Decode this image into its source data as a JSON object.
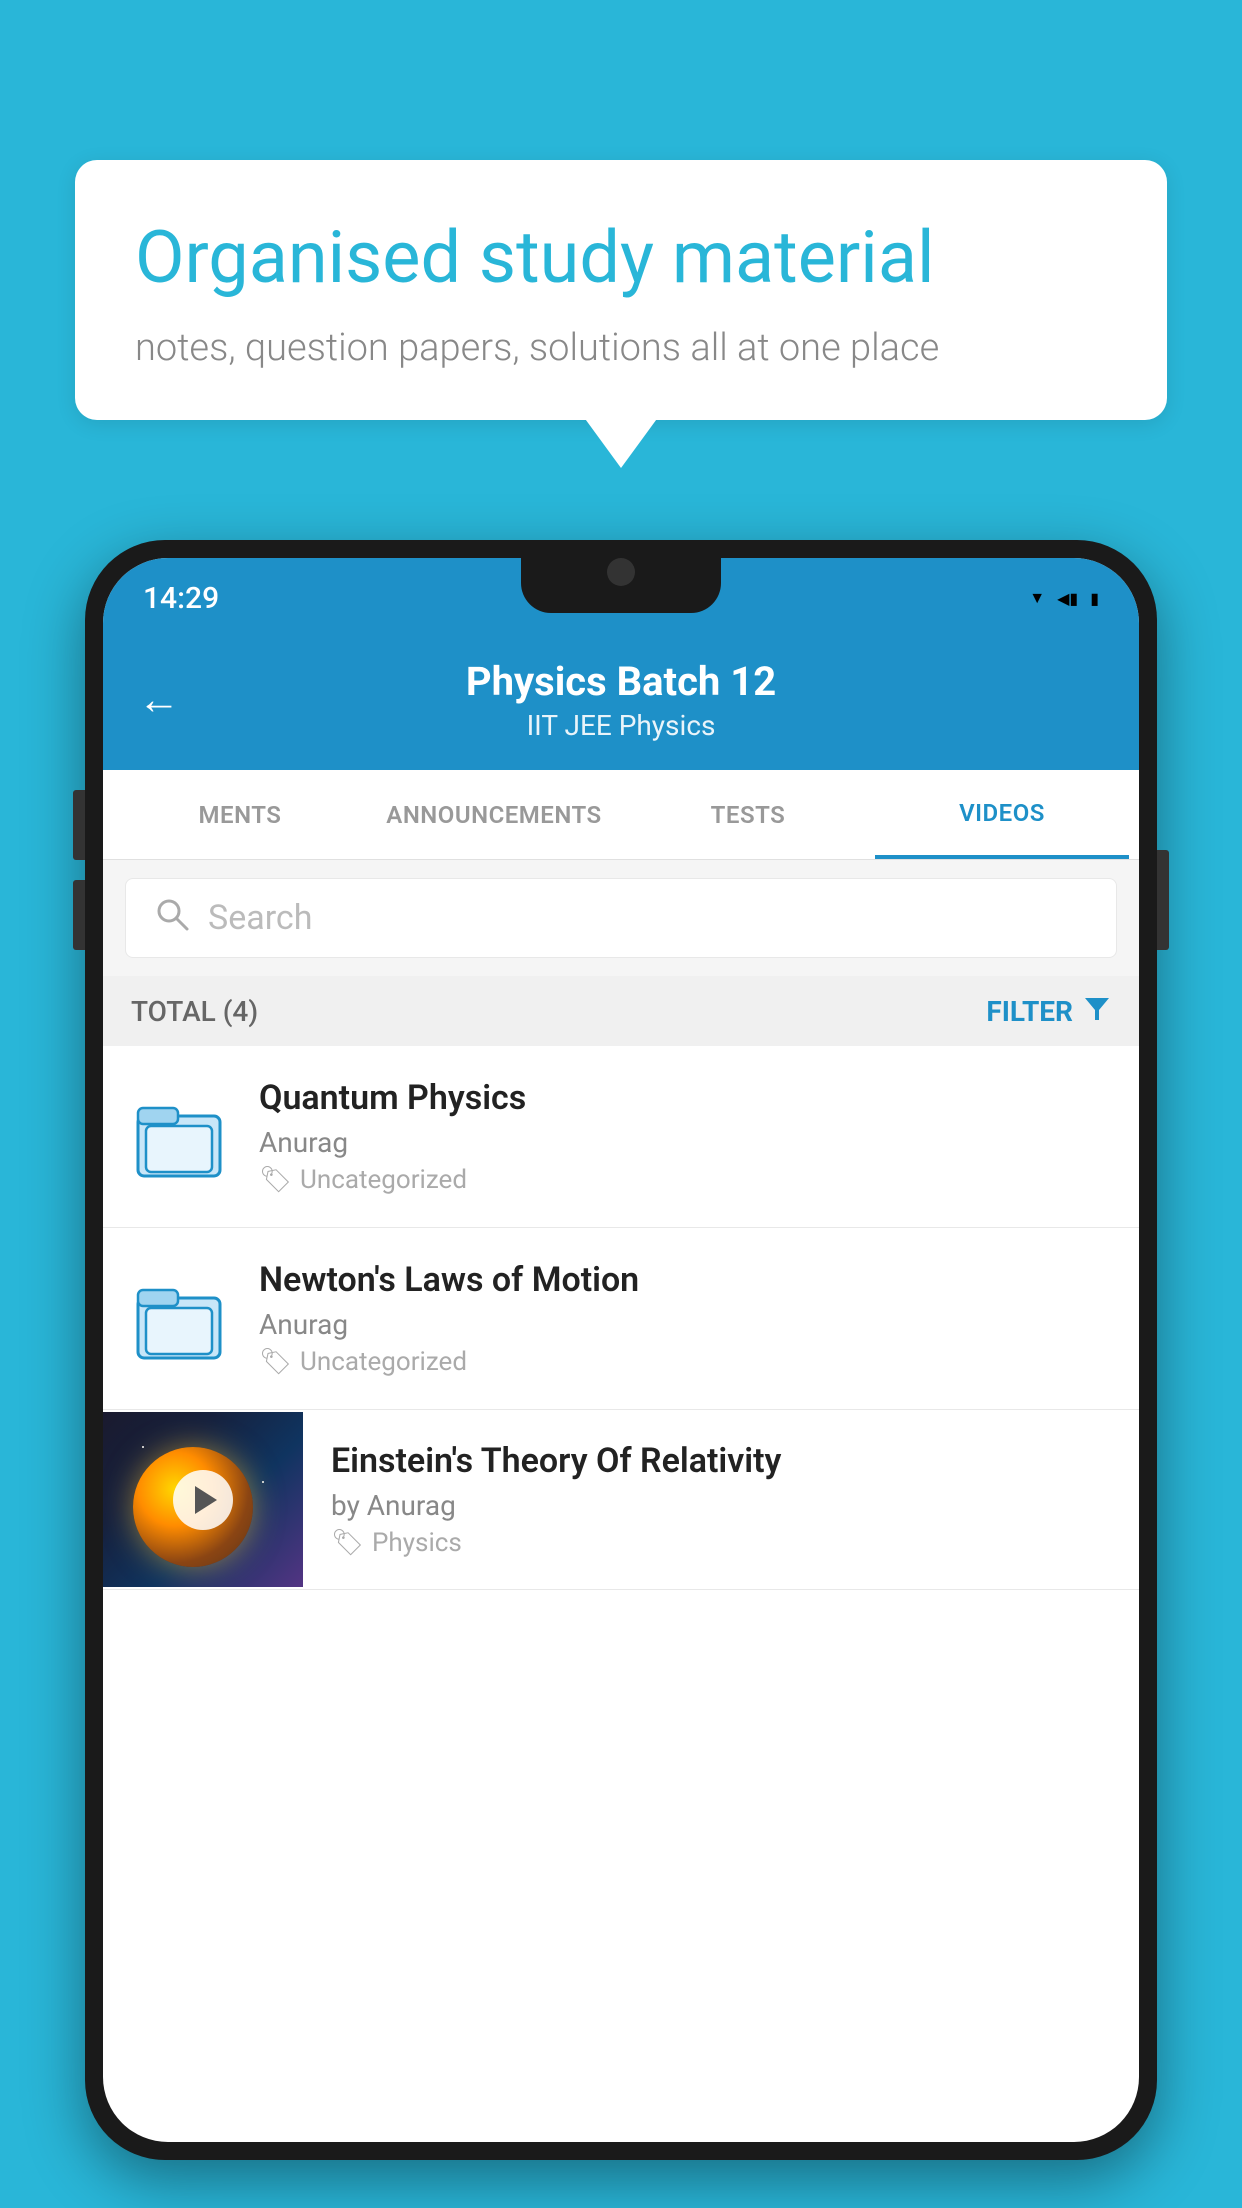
{
  "background": {
    "color": "#29b6d8"
  },
  "bubble": {
    "title": "Organised study material",
    "subtitle": "notes, question papers, solutions all at one place"
  },
  "status_bar": {
    "time": "14:29",
    "wifi": "▼",
    "signal": "◀",
    "battery": "▮"
  },
  "header": {
    "title": "Physics Batch 12",
    "subtitle": "IIT JEE   Physics",
    "back_label": "←"
  },
  "tabs": [
    {
      "label": "MENTS",
      "active": false
    },
    {
      "label": "ANNOUNCEMENTS",
      "active": false
    },
    {
      "label": "TESTS",
      "active": false
    },
    {
      "label": "VIDEOS",
      "active": true
    }
  ],
  "search": {
    "placeholder": "Search"
  },
  "filter_row": {
    "total": "TOTAL (4)",
    "filter_label": "FILTER"
  },
  "videos": [
    {
      "title": "Quantum Physics",
      "author": "Anurag",
      "tag": "Uncategorized",
      "has_thumbnail": false
    },
    {
      "title": "Newton's Laws of Motion",
      "author": "Anurag",
      "tag": "Uncategorized",
      "has_thumbnail": false
    },
    {
      "title": "Einstein's Theory Of Relativity",
      "author": "by Anurag",
      "tag": "Physics",
      "has_thumbnail": true
    }
  ]
}
